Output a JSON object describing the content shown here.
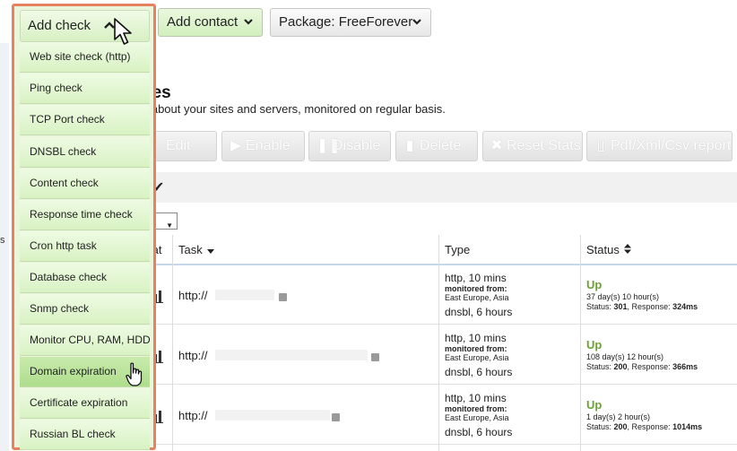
{
  "toolbar": {
    "add_check_label": "Add check",
    "add_contact_label": "Add contact",
    "package_label": "Package: FreeForever"
  },
  "section": {
    "title": "ites",
    "description": "n about your sites and servers, monitored on regular basis."
  },
  "actions": [
    {
      "label": "Edit",
      "icon": "edit-icon"
    },
    {
      "label": "Enable",
      "icon": "play-icon"
    },
    {
      "label": "Disable",
      "icon": "pause-icon"
    },
    {
      "label": "Delete",
      "icon": "trash-icon"
    },
    {
      "label": "Reset Stats",
      "icon": "close-icon"
    },
    {
      "label": "Pdf/Xml/Csv report",
      "icon": "document-icon"
    }
  ],
  "page_size_value": "0",
  "left_stub": "s",
  "table": {
    "headers": {
      "stat": "tat",
      "task": "Task",
      "type": "Type",
      "status": "Status"
    },
    "rows": [
      {
        "task": "http://",
        "type_main": "http, 10 mins",
        "monitored_label": "monitored from:",
        "regions": "East Europe, Asia",
        "type_extra": "dnsbl, 6 hours",
        "status": "Up",
        "uptime": "37 day(s) 10 hour(s)",
        "status_label": "Status: ",
        "status_code": "301",
        "response_label": ", Response: ",
        "response": "324ms"
      },
      {
        "task": "http://",
        "type_main": "http, 10 mins",
        "monitored_label": "monitored from:",
        "regions": "East Europe, Asia",
        "type_extra": "dnsbl, 6 hours",
        "status": "Up",
        "uptime": "108 day(s) 12 hour(s)",
        "status_label": "Status: ",
        "status_code": "200",
        "response_label": ", Response: ",
        "response": "366ms"
      },
      {
        "task": "http://",
        "type_main": "http, 10 mins",
        "monitored_label": "monitored from:",
        "regions": "East Europe, Asia",
        "type_extra": "dnsbl, 6 hours",
        "status": "Up",
        "uptime": "1 day(s) 2 hour(s)",
        "status_label": "Status: ",
        "status_code": "200",
        "response_label": ", Response: ",
        "response": "1014ms"
      }
    ]
  },
  "dropdown": {
    "items": [
      "Web site check (http)",
      "Ping check",
      "TCP Port check",
      "DNSBL check",
      "Content check",
      "Response time check",
      "Cron http task",
      "Database check",
      "Snmp check",
      "Monitor CPU, RAM, HDD",
      "Domain expiration",
      "Certificate expiration",
      "Russian BL check"
    ],
    "hovered_item": "Domain expiration"
  },
  "colors": {
    "accent_green": "#6aa233",
    "highlight_border": "#e8825e",
    "menu_bg": "#e9f6dc",
    "menu_hover": "#b8e296"
  }
}
